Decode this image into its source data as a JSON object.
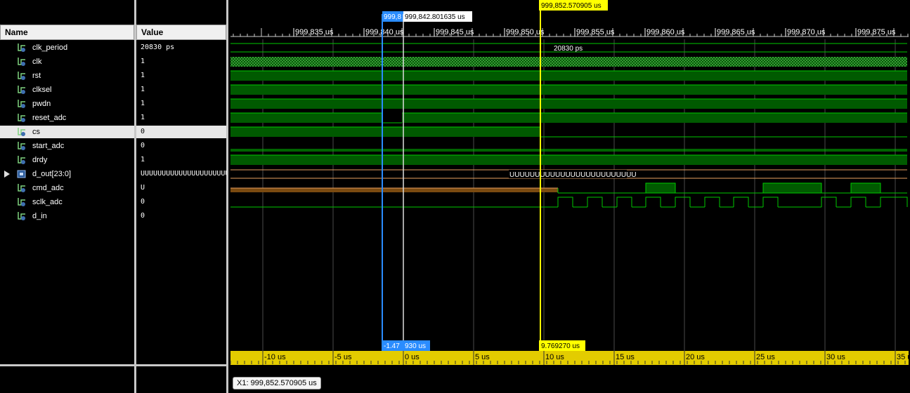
{
  "columns": {
    "name": "Name",
    "value": "Value"
  },
  "signals": [
    {
      "name": "clk_period",
      "value": "20830 ps",
      "kind": "scalar",
      "selected": false
    },
    {
      "name": "clk",
      "value": "1",
      "kind": "scalar",
      "selected": false
    },
    {
      "name": "rst",
      "value": "1",
      "kind": "scalar",
      "selected": false
    },
    {
      "name": "clksel",
      "value": "1",
      "kind": "scalar",
      "selected": false
    },
    {
      "name": "pwdn",
      "value": "1",
      "kind": "scalar",
      "selected": false
    },
    {
      "name": "reset_adc",
      "value": "1",
      "kind": "scalar",
      "selected": false
    },
    {
      "name": "cs",
      "value": "0",
      "kind": "scalar",
      "selected": true
    },
    {
      "name": "start_adc",
      "value": "0",
      "kind": "scalar",
      "selected": false
    },
    {
      "name": "drdy",
      "value": "1",
      "kind": "scalar",
      "selected": false
    },
    {
      "name": "d_out[23:0]",
      "value": "UUUUUUUUUUUUUUUUUUUUUUUU",
      "kind": "bus",
      "selected": false
    },
    {
      "name": "cmd_adc",
      "value": "U",
      "kind": "scalar",
      "selected": false
    },
    {
      "name": "sclk_adc",
      "value": "0",
      "kind": "scalar",
      "selected": false
    },
    {
      "name": "d_in",
      "value": "0",
      "kind": "scalar",
      "selected": false
    }
  ],
  "top_ruler": {
    "labels": [
      "999,835 us",
      "999,840 us",
      "999,845 us",
      "999,850 us",
      "999,855 us",
      "999,860 us",
      "999,865 us",
      "999,870 us",
      "999,875 us"
    ]
  },
  "bottom_ruler": {
    "labels": [
      "-10 us",
      "-5 us",
      "0 us",
      "5 us",
      "10 us",
      "15 us",
      "20 us",
      "25 us",
      "30 us",
      "35 us"
    ]
  },
  "cursors": {
    "main": {
      "time": "999,852.570905 us",
      "delta": "9.769270 us"
    },
    "marker_blue": {
      "time_label": "999,8",
      "delta": "-1.47",
      "delta_tail": "930 us"
    },
    "marker_white": {
      "time": "999,842.801635 us"
    }
  },
  "waveform_labels": {
    "clk_period_value": "20830 ps",
    "d_out_value": "UUUUUUUUUUUUUUUUUUUUUUUUU"
  },
  "status": {
    "cursor_readout": "X1: 999,852.570905 us"
  },
  "colors": {
    "signal_green": "#00c800",
    "signal_fill": "#005a00",
    "cursor_yellow": "#ffff00",
    "marker_blue": "#2a8cff",
    "bus_orange": "#e8a060",
    "undef_brown": "#7a4a10"
  }
}
